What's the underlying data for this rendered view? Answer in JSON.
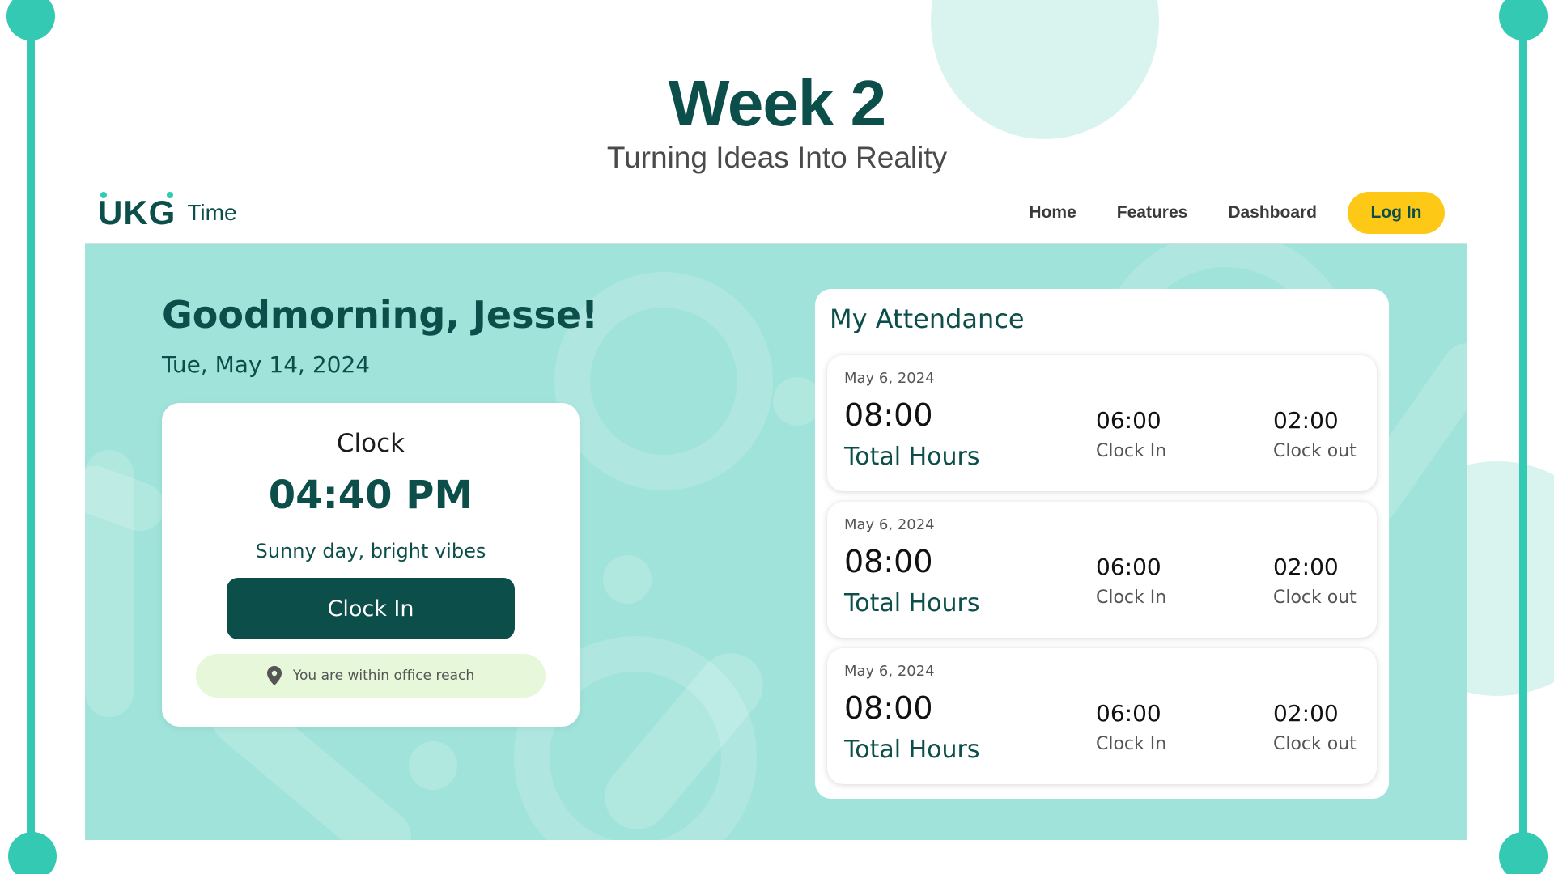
{
  "slide": {
    "title": "Week 2",
    "subtitle": "Turning Ideas Into Reality"
  },
  "brand": {
    "logo_text": "UKG",
    "name": "Time"
  },
  "nav": {
    "items": [
      {
        "label": "Home"
      },
      {
        "label": "Features"
      },
      {
        "label": "Dashboard"
      }
    ],
    "login_label": "Log In"
  },
  "greeting": {
    "text": "Goodmorning, Jesse!",
    "date": "Tue, May 14, 2024"
  },
  "clock": {
    "title": "Clock",
    "time": "04:40 PM",
    "vibe": "Sunny day, bright vibes",
    "button_label": "Clock In",
    "location_text": "You are within office reach",
    "location_icon": "map-pin-icon"
  },
  "attendance": {
    "title": "My Attendance",
    "records": [
      {
        "date": "May 6, 2024",
        "total": "08:00",
        "total_label": "Total Hours",
        "clock_in": "06:00",
        "clock_in_label": "Clock In",
        "clock_out": "02:00",
        "clock_out_label": "Clock out"
      },
      {
        "date": "May 6, 2024",
        "total": "08:00",
        "total_label": "Total Hours",
        "clock_in": "06:00",
        "clock_in_label": "Clock In",
        "clock_out": "02:00",
        "clock_out_label": "Clock out"
      },
      {
        "date": "May 6, 2024",
        "total": "08:00",
        "total_label": "Total Hours",
        "clock_in": "06:00",
        "clock_in_label": "Clock In",
        "clock_out": "02:00",
        "clock_out_label": "Clock out"
      }
    ]
  },
  "colors": {
    "primary": "#0b4e4a",
    "accent": "#33c9b2",
    "background": "#9fe3da",
    "login_button": "#fec817",
    "location_pill": "#e7f7d9"
  }
}
